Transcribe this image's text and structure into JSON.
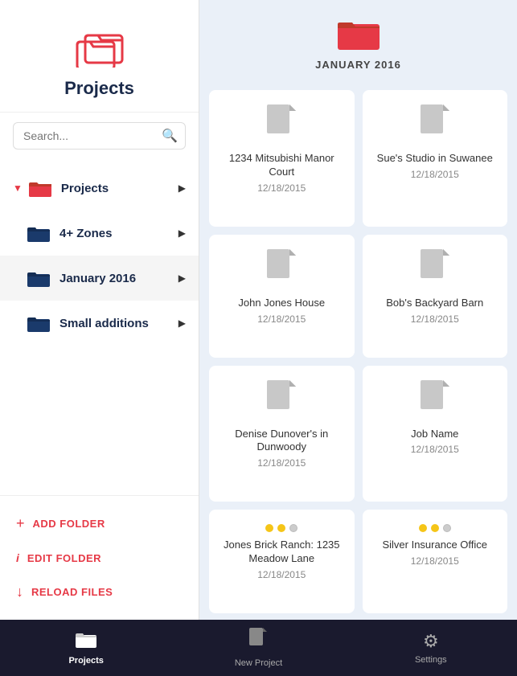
{
  "sidebar": {
    "title": "Projects",
    "search_placeholder": "Search...",
    "nav_items": [
      {
        "id": "projects",
        "label": "Projects",
        "type": "root",
        "expanded": true
      },
      {
        "id": "4plus-zones",
        "label": "4+ Zones",
        "type": "folder"
      },
      {
        "id": "january-2016",
        "label": "January 2016",
        "type": "folder",
        "active": true
      },
      {
        "id": "small-additions",
        "label": "Small additions",
        "type": "folder"
      }
    ],
    "actions": [
      {
        "id": "add-folder",
        "label": "ADD FOLDER",
        "icon": "+"
      },
      {
        "id": "edit-folder",
        "label": "EDIT FOLDER",
        "icon": "i"
      },
      {
        "id": "reload-files",
        "label": "RELOAD FILES",
        "icon": "↓"
      }
    ]
  },
  "main": {
    "folder_title": "JANUARY 2016",
    "grid_items": [
      {
        "id": "item1",
        "name": "1234 Mitsubishi Manor Court",
        "date": "12/18/2015",
        "has_dots": false
      },
      {
        "id": "item2",
        "name": "Sue's Studio in Suwanee",
        "date": "12/18/2015",
        "has_dots": false
      },
      {
        "id": "item3",
        "name": "John Jones House",
        "date": "12/18/2015",
        "has_dots": false
      },
      {
        "id": "item4",
        "name": "Bob's Backyard Barn",
        "date": "12/18/2015",
        "has_dots": false
      },
      {
        "id": "item5",
        "name": "Denise Dunover's in Dunwoody",
        "date": "12/18/2015",
        "has_dots": false
      },
      {
        "id": "item6",
        "name": "Job Name",
        "date": "12/18/2015",
        "has_dots": false
      },
      {
        "id": "item7",
        "name": "Jones Brick Ranch: 1235 Meadow Lane",
        "date": "12/18/2015",
        "has_dots": true,
        "dot_pattern": "yellow-yellow-gray"
      },
      {
        "id": "item8",
        "name": "Silver Insurance Office",
        "date": "12/18/2015",
        "has_dots": true,
        "dot_pattern": "yellow-yellow-gray"
      }
    ]
  },
  "bottom_nav": {
    "items": [
      {
        "id": "projects-tab",
        "label": "Projects",
        "active": true
      },
      {
        "id": "new-project-tab",
        "label": "New Project",
        "active": false
      },
      {
        "id": "settings-tab",
        "label": "Settings",
        "active": false
      }
    ]
  }
}
